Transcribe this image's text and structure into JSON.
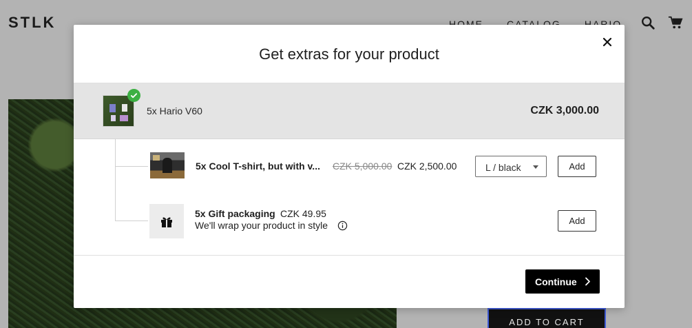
{
  "header": {
    "logo": "STLK",
    "nav": [
      {
        "label": "HOME"
      },
      {
        "label": "CATALOG"
      },
      {
        "label": "HARIO"
      }
    ],
    "icons": {
      "search": "search-icon",
      "cart": "cart-icon"
    }
  },
  "product_page": {
    "add_to_cart_label": "ADD TO CART"
  },
  "modal": {
    "title": "Get extras for your product",
    "close_icon": "close-icon",
    "main_product": {
      "name": "5x Hario V60",
      "price": "CZK 3,000.00",
      "selected": true
    },
    "addons": [
      {
        "name": "5x Cool T-shirt, but with v...",
        "old_price": "CZK 5,000.00",
        "price": "CZK 2,500.00",
        "variant": "L / black",
        "add_label": "Add"
      },
      {
        "name": "5x Gift packaging",
        "price": "CZK 49.95",
        "description": "We'll wrap your product in style",
        "icon": "gift-icon",
        "add_label": "Add"
      }
    ],
    "continue_label": "Continue"
  },
  "colors": {
    "overlay": "#b3b3b3",
    "check": "#3cb043",
    "primary_button": "#000000"
  }
}
